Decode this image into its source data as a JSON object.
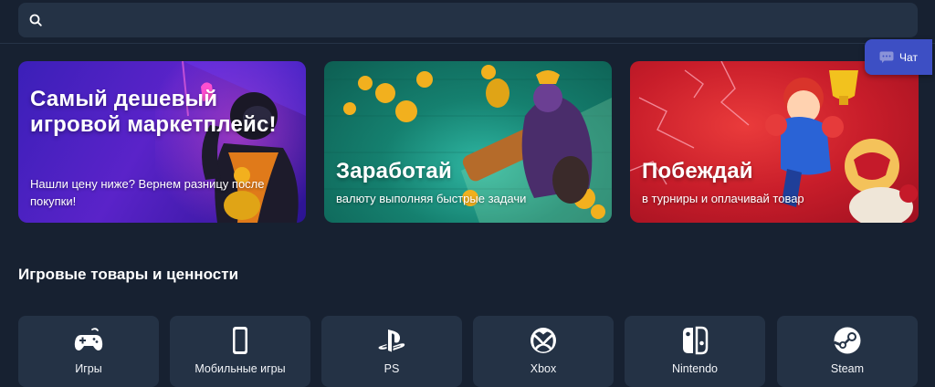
{
  "search": {
    "placeholder": "",
    "value": ""
  },
  "chat": {
    "label": "Чат"
  },
  "banners": [
    {
      "title": "Самый дешевый игровой маркетплейс!",
      "subtitle": "Нашли цену ниже? Вернем разницу после покупки!"
    },
    {
      "title": "Заработай",
      "subtitle": "валюту выполняя быстрые задачи"
    },
    {
      "title": "Побеждай",
      "subtitle": "в турниры и оплачивай товар"
    }
  ],
  "section": {
    "title": "Игровые товары и ценности"
  },
  "categories": [
    {
      "label": "Игры",
      "icon": "gamepad-icon"
    },
    {
      "label": "Мобильные игры",
      "icon": "smartphone-icon"
    },
    {
      "label": "PS",
      "icon": "playstation-icon"
    },
    {
      "label": "Xbox",
      "icon": "xbox-icon"
    },
    {
      "label": "Nintendo",
      "icon": "nintendo-switch-icon"
    },
    {
      "label": "Steam",
      "icon": "steam-icon"
    }
  ],
  "colors": {
    "background": "#172131",
    "panel": "#243245",
    "chat_accent": "#3d4fc4",
    "banner_purple": "#4a22c4",
    "banner_teal": "#15806f",
    "banner_red": "#c81d2a",
    "coin_gold": "#f2b01e"
  }
}
